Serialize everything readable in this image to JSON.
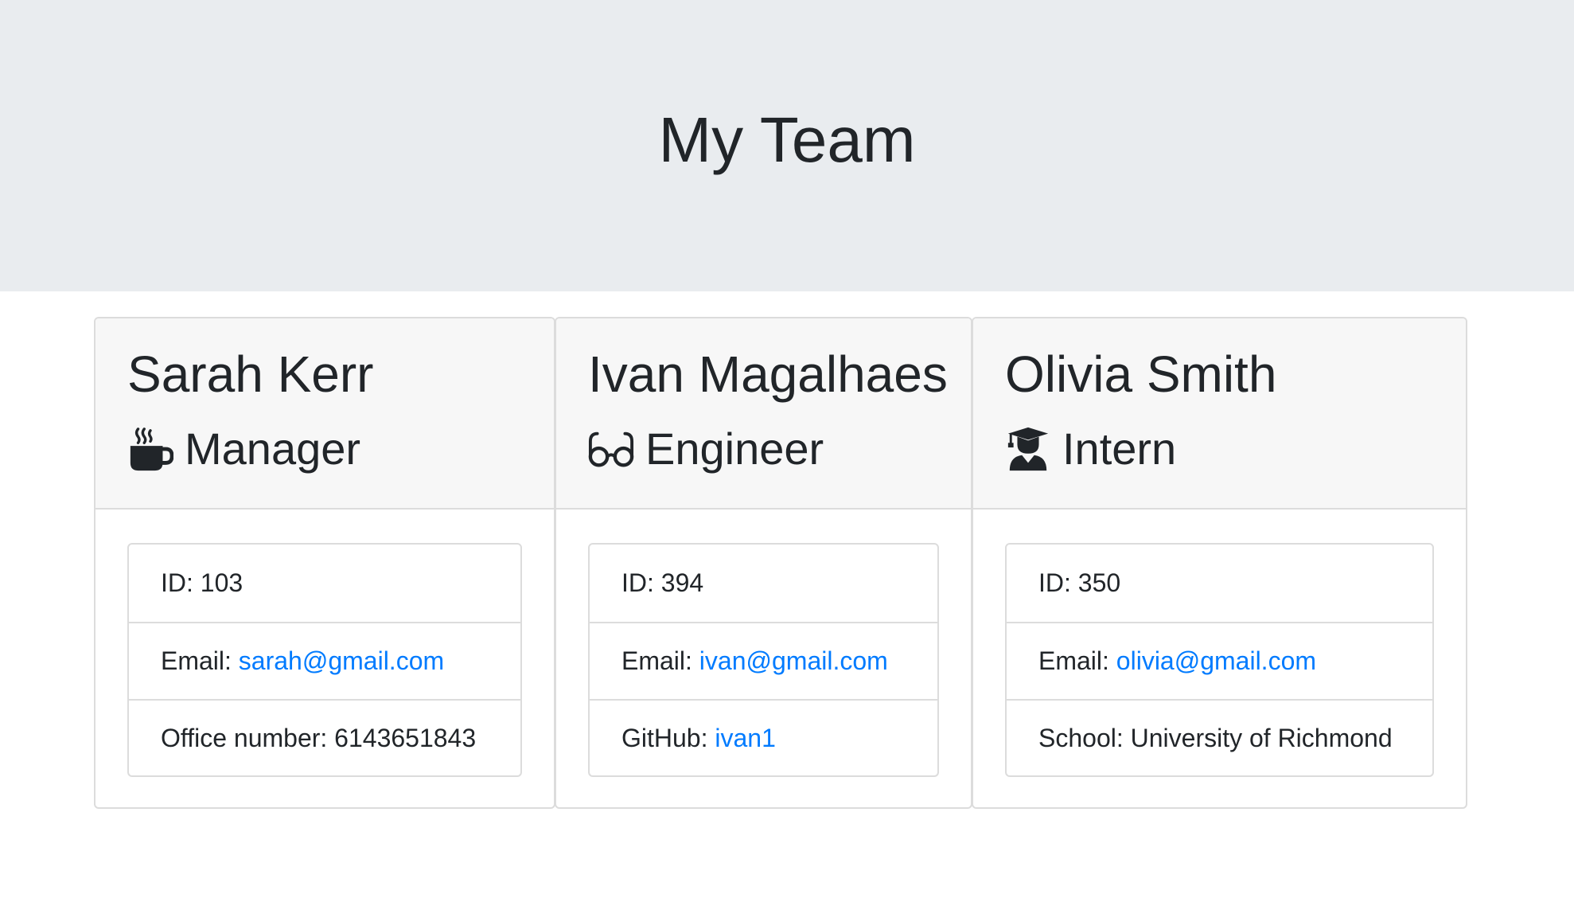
{
  "header": {
    "title": "My Team"
  },
  "colors": {
    "jumbotron_bg": "#e9ecef",
    "card_header_bg": "#f7f7f7",
    "link": "#007bff",
    "text": "#212529"
  },
  "employees": [
    {
      "name": "Sarah Kerr",
      "role": "Manager",
      "role_icon": "coffee-mug-icon",
      "id_label": "ID: ",
      "id": "103",
      "email_label": "Email: ",
      "email": "sarah@gmail.com",
      "extra_label": "Office number: ",
      "extra_value": "6143651843"
    },
    {
      "name": "Ivan Magalhaes",
      "role": "Engineer",
      "role_icon": "glasses-icon",
      "id_label": "ID: ",
      "id": "394",
      "email_label": "Email: ",
      "email": "ivan@gmail.com",
      "extra_label": "GitHub: ",
      "extra_value": "ivan1"
    },
    {
      "name": "Olivia Smith",
      "role": "Intern",
      "role_icon": "graduate-icon",
      "id_label": "ID: ",
      "id": "350",
      "email_label": "Email: ",
      "email": "olivia@gmail.com",
      "extra_label": "School: ",
      "extra_value": "University of Richmond"
    }
  ]
}
